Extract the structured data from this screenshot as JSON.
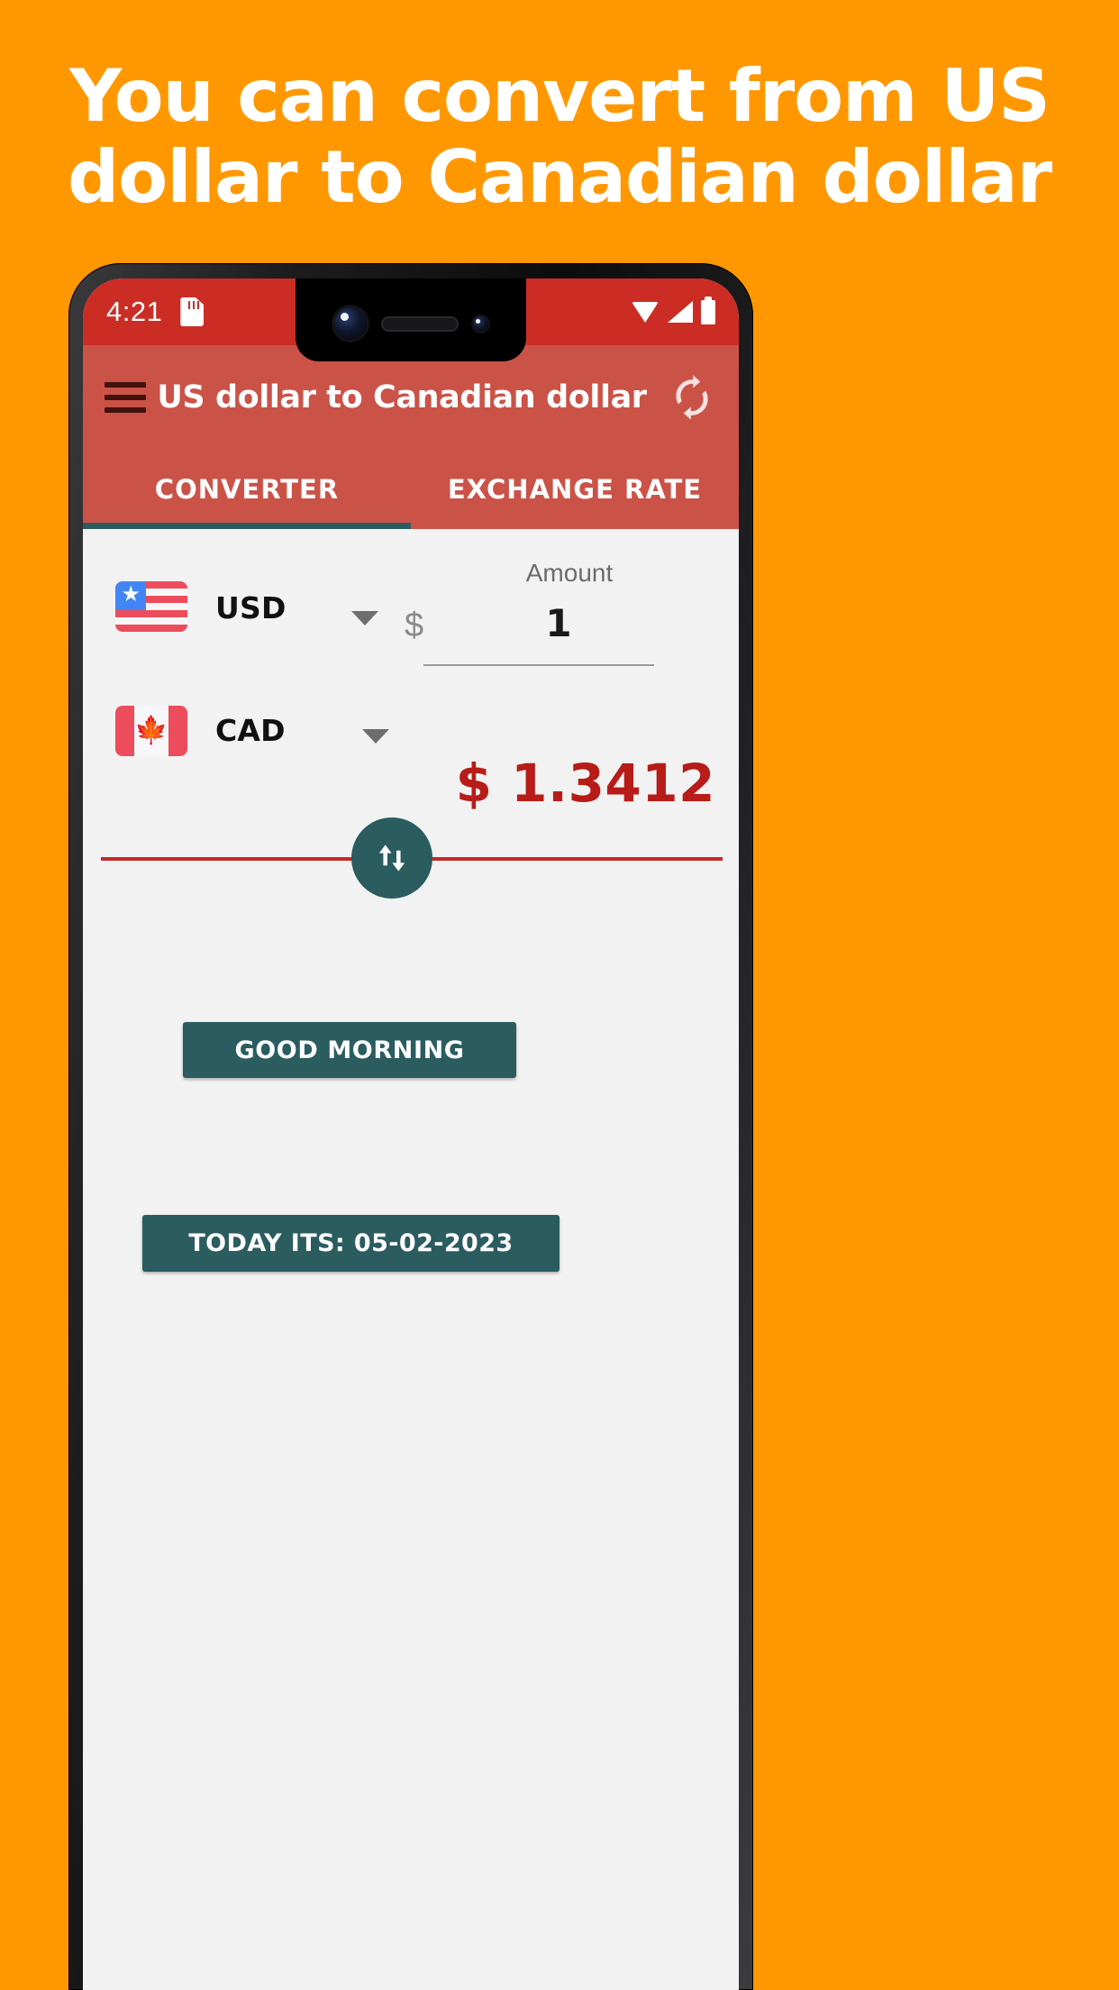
{
  "promo": {
    "line1": "You can convert from US",
    "line2": "dollar to Canadian dollar",
    "background_color": "#FF9800",
    "text_color": "#FFFFFF"
  },
  "status_bar": {
    "time": "4:21",
    "sd_card_icon": "sd-card-icon",
    "wifi_icon": "wifi-icon",
    "signal_icon": "cellular-signal-icon",
    "battery_icon": "battery-full-icon",
    "background_color": "#CB2D25"
  },
  "app_bar": {
    "menu_icon": "hamburger-menu-icon",
    "title": "US dollar to Canadian dollar",
    "refresh_icon": "refresh-sync-icon",
    "background_color": "#CB5247"
  },
  "tabs": {
    "items": [
      {
        "label": "CONVERTER",
        "active": true
      },
      {
        "label": "EXCHANGE RATE",
        "active": false
      }
    ],
    "indicator_color": "#2A5C60"
  },
  "converter": {
    "from": {
      "flag": "us-flag-icon",
      "code": "USD",
      "dropdown_icon": "chevron-down-icon",
      "currency_symbol": "$",
      "amount_label": "Amount",
      "amount_value": "1"
    },
    "to": {
      "flag": "canada-flag-icon",
      "code": "CAD",
      "dropdown_icon": "chevron-down-icon",
      "result": "$ 1.3412",
      "result_color": "#B71C18"
    },
    "swap_icon": "swap-vertical-arrows-icon",
    "divider_color": "#C62828"
  },
  "actions": {
    "greeting_button": "GOOD MORNING",
    "date_button": "TODAY ITS: 05-02-2023",
    "button_color": "#2A5C60"
  }
}
